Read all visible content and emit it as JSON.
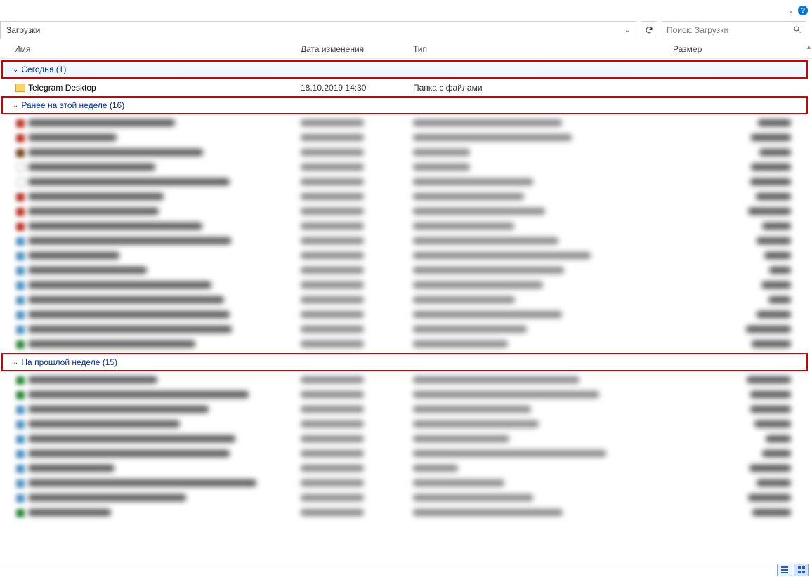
{
  "address": {
    "path": "Загрузки"
  },
  "search": {
    "placeholder": "Поиск: Загрузки"
  },
  "columns": {
    "name": "Имя",
    "date": "Дата изменения",
    "type": "Тип",
    "size": "Размер"
  },
  "groups": {
    "today": {
      "label": "Сегодня (1)"
    },
    "thisweek": {
      "label": "Ранее на этой неделе (16)"
    },
    "lastweek": {
      "label": "На прошлой неделе (15)"
    }
  },
  "rows": {
    "telegram": {
      "name": "Telegram Desktop",
      "date": "18.10.2019 14:30",
      "type": "Папка с файлами",
      "size": ""
    }
  },
  "blurred_thisweek_count": 16,
  "blurred_lastweek_count": 10
}
